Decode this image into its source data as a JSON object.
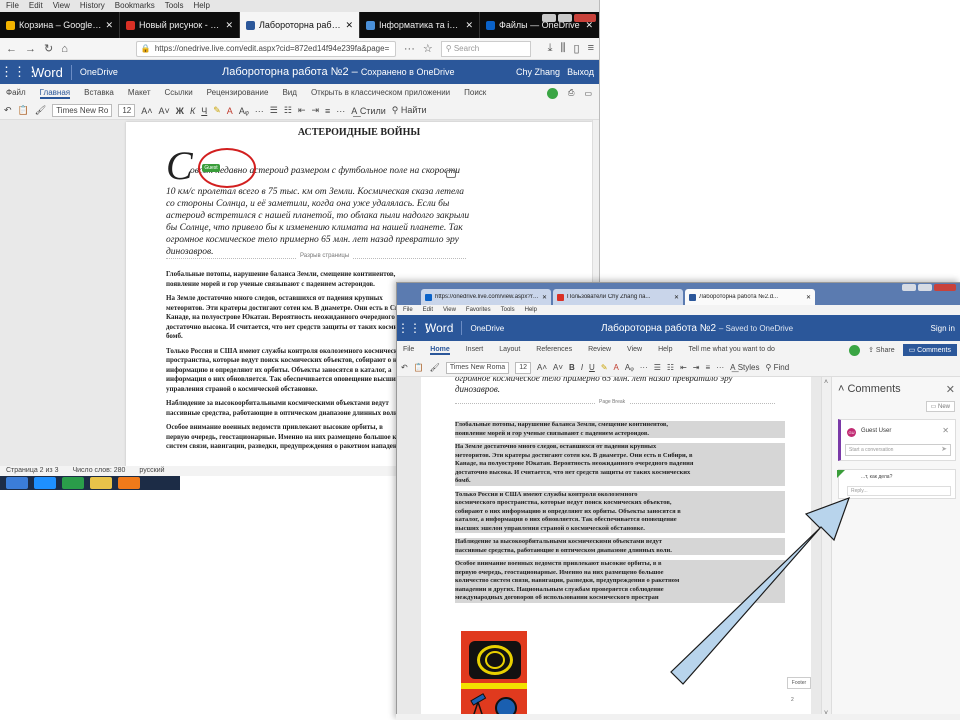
{
  "back_window": {
    "menu": [
      "File",
      "Edit",
      "View",
      "History",
      "Bookmarks",
      "Tools",
      "Help"
    ],
    "tabs": [
      {
        "label": "Корзина – Google Диск",
        "color": "#f4b400",
        "active": false
      },
      {
        "label": "Новый рисунок - Google Рис",
        "color": "#d93025",
        "active": false
      },
      {
        "label": "Лабороторна работа №2.doc",
        "color": "#2b579a",
        "active": true
      },
      {
        "label": "Інформатика та інформацій",
        "color": "#4a90d9",
        "active": false
      },
      {
        "label": "Файлы — OneDrive",
        "color": "#0a62c9",
        "active": false
      }
    ],
    "url": "https://onedrive.live.com/edit.aspx?cid=872ed14f94e239fa&page=",
    "search_placeholder": "Search",
    "word": {
      "app": "Word",
      "onedrive": "OneDrive",
      "doc_title": "Лабороторна работа №2",
      "save_status": "Сохранено в OneDrive",
      "user": "Chy Zhang",
      "exit": "Выход"
    },
    "ribbon_tabs": [
      "Файл",
      "Главная",
      "Вставка",
      "Макет",
      "Ссылки",
      "Рецензирование",
      "Вид",
      "Открыть в классическом приложении",
      "Поиск"
    ],
    "ribbon_tools": {
      "font": "Times New Ro",
      "size": "12",
      "styles": "Стили",
      "find": "Найти"
    },
    "doc": {
      "title": "АСТЕРОИДНЫЕ ВОЙНЫ",
      "dropcap": "С",
      "first_line": "овсем недавно астероид размером с футбольное поле на скорости",
      "guest_badge": "Guest",
      "italic_lines": [
        "10 км/с пролетал всего в 75 тыс. км от Земли. Космическая сказа летела",
        "со стороны Солнца, и её заметили, когда она уже удалялась. Если бы",
        "астероид встретился с нашей планетой, то облака пыли надолго закрыли",
        "бы Солнце, что привело бы к изменению климата на нашей планете. Так",
        "огромное космическое тело примерно 65 млн. лет назад превратило эру",
        "динозавров."
      ],
      "page_break": "Разрыв страницы",
      "paragraph_lines": [
        "Глобальные потопы, нарушение баланса Земли, смещение континентов,",
        "появление морей и гор ученые связывают с падением астероидов.",
        "",
        "На Земле достаточно много следов, оставшихся от падения крупных",
        "метеоритов. Эти кратеры достигают сотен км. В диаметре. Они есть в Сибири, в",
        "Канаде, на полуострове Юкатан. Вероятность неожиданного очередного падения",
        "достаточно высока. И считается, что нет средств защиты от таких космических",
        "бомб.",
        "",
        "Только Россия и США имеют службы контроля околоземного космического",
        "пространства, которые ведут поиск космических объектов, собирают о них",
        "информацию и определяют их орбиты. Объекты заносятся в каталог, а",
        "информация о них обновляется. Так обеспечивается оповещение высших эшелонов",
        "управления страной о космической обстановке.",
        "",
        "Наблюдение за высокоорбитальными космическими объектами ведут",
        "пассивные средства, работающие в оптическом диапазоне длинных волн.",
        "",
        "Особое внимание военных ведомств привлекают высокие орбиты, в",
        "первую очередь, геостационарные. Именно на них размещено большое количество",
        "систем связи, навигации, разведки, предупреждения о ракетном нападении"
      ]
    },
    "status": [
      "Страница 2 из 3",
      "Число слов: 280",
      "русский"
    ],
    "taskbar_colors": [
      "#3b7dd8",
      "#1e90ff",
      "#2a9d4a",
      "#e8c34a",
      "#f07a1a"
    ]
  },
  "front_window": {
    "tabs": [
      {
        "label": "https://onedrive.live.com/view.aspx?resid=872ED14F94E239FA",
        "color": "#0a62c9",
        "active": false
      },
      {
        "label": "Пользователи Chy Zhang па...",
        "color": "#d93025",
        "active": false
      },
      {
        "label": "Лабороторна работа №2.d...",
        "color": "#2b579a",
        "active": true
      }
    ],
    "menu": [
      "File",
      "Edit",
      "View",
      "Favorites",
      "Tools",
      "Help"
    ],
    "word": {
      "app": "Word",
      "onedrive": "OneDrive",
      "doc_title": "Лабороторна работа №2",
      "save_status": "Saved to OneDrive",
      "signin": "Sign in"
    },
    "ribbon_tabs": [
      "File",
      "Home",
      "Insert",
      "Layout",
      "References",
      "Review",
      "View",
      "Help",
      "Tell me what you want to do"
    ],
    "share": "Share",
    "comments_btn": "Comments",
    "ribbon_tools": {
      "font": "Times New Roma",
      "size": "12",
      "styles": "Styles",
      "find": "Find"
    },
    "doc": {
      "italic_lines": [
        "огромное космическое тело примерно 65 млн. лет назад превратило эру",
        "динозавров."
      ],
      "page_break": "Page Break",
      "paragraph_lines": [
        "Глобальные потопы, нарушение баланса Земли, смещение континентов,",
        "появление морей и гор ученые связывают с падением астероидов.",
        "",
        "На Земле достаточно много следов, оставшихся от падения крупных",
        "метеоритов. Эти кратеры достигают сотен км. В диаметре. Они есть в Сибири, в",
        "Канаде, на полуострове Юкатан. Вероятность неожиданного очередного падения",
        "достаточно высока. И считается, что нет средств защиты от таких космических",
        "бомб.",
        "",
        "Только Россия и США имеют службы контроля околоземного",
        "космического пространства, которые ведут поиск космических объектов,",
        "собирают о них информацию и определяют их орбиты. Объекты заносятся в",
        "каталог, а информация о них обновляется. Так обеспечивается оповещение",
        "высших эшелон управления страной о космической обстановке.",
        "",
        "Наблюдение за высокоорбитальными космическими объектами ведут",
        "пассивные средства, работающие в оптическом диапазоне длинных волн.",
        "",
        "Особое внимание военных ведомств привлекают высокие орбиты, в в",
        "первую очередь, геостационарные. Именно на них размещено большое",
        "количество систем связи, навигации, разведки, предупреждения о ракетном",
        "нападении и других. Национальным службам проверяется соблюдение",
        "международных договоров об использовании космического простран"
      ],
      "footer_label": "Footer",
      "page_number": "2"
    },
    "comments_panel": {
      "title": "Comments",
      "new_btn": "New",
      "user": "Guest User",
      "conversation_placeholder": "Start a conversation",
      "reply_text": "...т, как дела?",
      "reply_placeholder": "Reply..."
    }
  },
  "annotation": {
    "arrow_color": "#b8d4ec",
    "arrow_outline": "#1a1a1a",
    "circle_color": "#d21f1f"
  }
}
